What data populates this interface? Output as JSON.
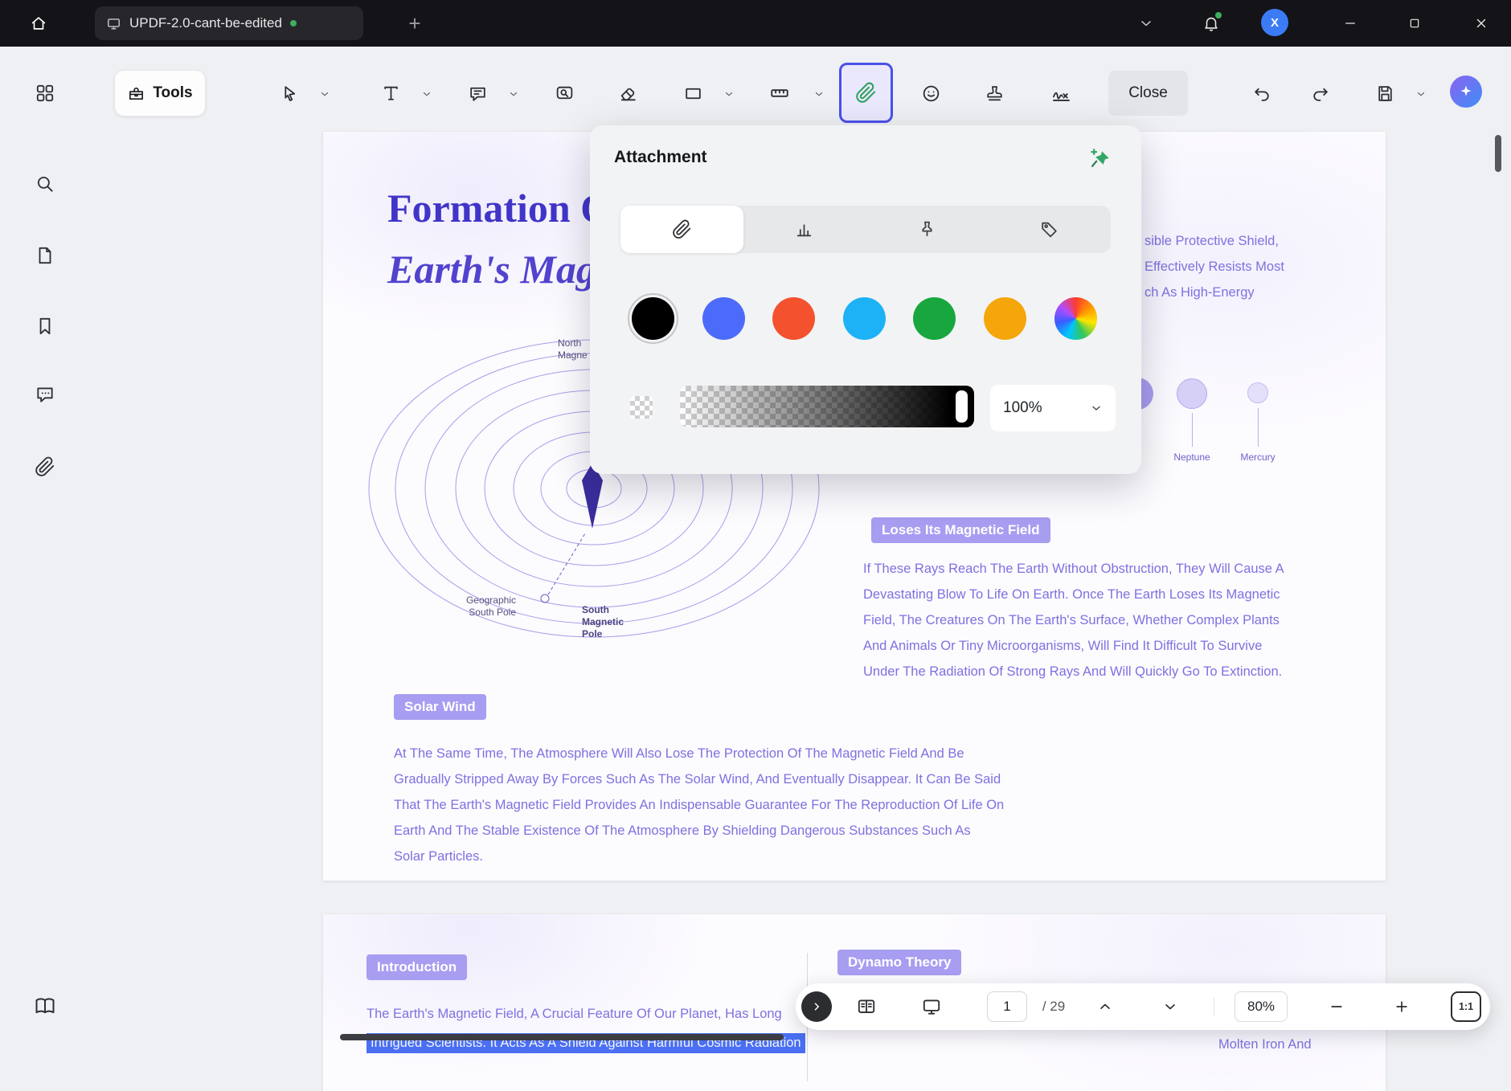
{
  "titlebar": {
    "tab_title": "UPDF-2.0-cant-be-edited",
    "avatar_letter": "X"
  },
  "toolbar": {
    "tools_label": "Tools",
    "close_label": "Close"
  },
  "attachment_panel": {
    "title": "Attachment",
    "opacity_value": "100%",
    "colors": [
      "#000000",
      "#4d6bfa",
      "#f4512e",
      "#1cb2f5",
      "#18a73f",
      "#f5a60a"
    ],
    "rainbow": "conic-gradient(#ff3b30,#ff9500,#ffe600,#34c759,#00c7ff,#3b5bff,#b04cff,#ff3b30)"
  },
  "document": {
    "page1": {
      "title_line1": "Formation O",
      "title_line2": "Earth's Mag",
      "north_label_1": "North",
      "north_label_2": "Magne",
      "geo_label_1": "Geographic",
      "geo_label_2": "South Pole",
      "south_label_1": "South",
      "south_label_2": "Magnetic",
      "south_label_3": "Pole",
      "right_fragments": [
        "sible Protective Shield,",
        "Effectively Resists Most",
        "ch As High-Energy"
      ],
      "planet_labels": [
        "Neptune",
        "Mercury"
      ],
      "badge_loses": "Loses Its Magnetic Field",
      "para_loses": "If These Rays Reach The Earth Without Obstruction, They Will Cause A Devastating Blow To Life On Earth. Once The Earth Loses Its Magnetic Field, The Creatures On The Earth's Surface, Whether Complex Plants And Animals Or Tiny Microorganisms, Will Find It Difficult To Survive Under The Radiation Of Strong Rays And Will Quickly Go To Extinction.",
      "badge_solar": "Solar Wind",
      "para_solar": "At The Same Time, The Atmosphere Will Also Lose The Protection Of The Magnetic Field And Be Gradually Stripped Away By Forces Such As The Solar Wind, And Eventually Disappear. It Can Be Said That The Earth's Magnetic Field Provides An Indispensable Guarantee For The Reproduction Of Life On Earth And The Stable Existence Of The Atmosphere By Shielding Dangerous Substances Such As Solar Particles."
    },
    "page2": {
      "badge_intro": "Introduction",
      "badge_dynamo": "Dynamo Theory",
      "line1": "The Earth's Magnetic Field, A Crucial Feature Of Our Planet, Has Long",
      "highlight_line": "Intrigued Scientists. It Acts As A Shield Against Harmful Cosmic Radiation",
      "right_fragment": "Molten Iron And"
    }
  },
  "bottom_bar": {
    "page_current": "1",
    "page_total": "/ 29",
    "zoom": "80%",
    "fit_label": "1:1"
  }
}
